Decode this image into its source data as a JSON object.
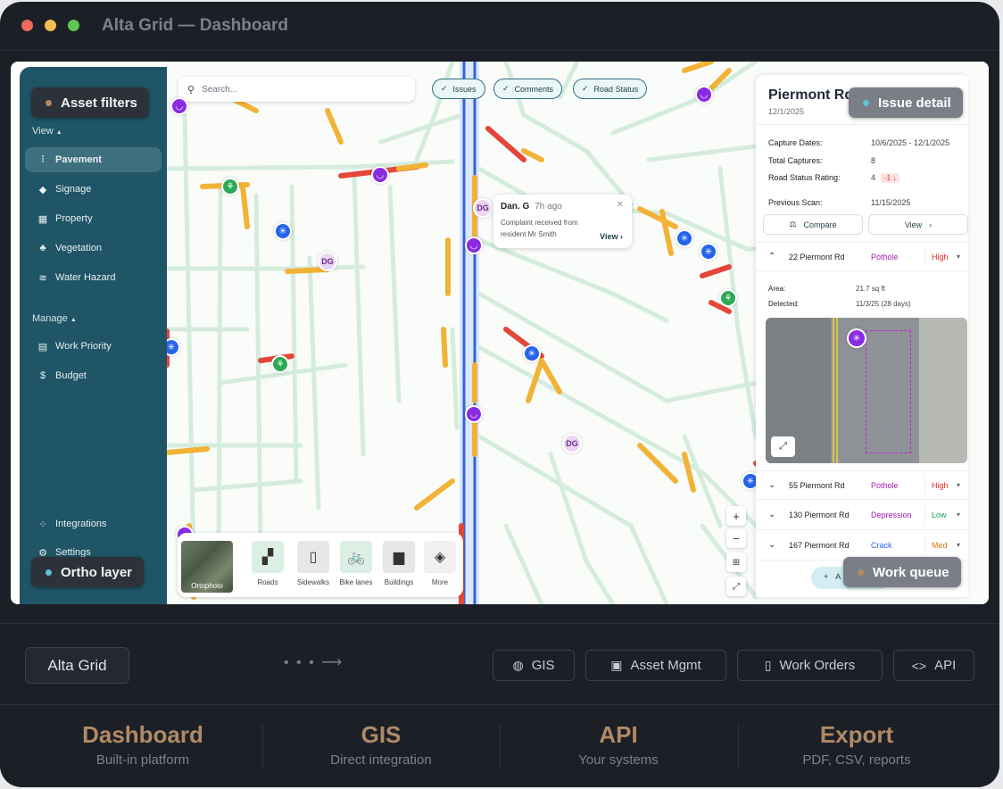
{
  "window": {
    "title": "Alta Grid — Dashboard"
  },
  "sidebar": {
    "view_label": "View",
    "manage_label": "Manage",
    "view_items": [
      {
        "label": "Pavement",
        "icon": "sliders-icon"
      },
      {
        "label": "Signage",
        "icon": "diamond-sign-icon"
      },
      {
        "label": "Property",
        "icon": "building-icon"
      },
      {
        "label": "Vegetation",
        "icon": "tree-icon"
      },
      {
        "label": "Water Hazard",
        "icon": "water-icon"
      }
    ],
    "manage_items": [
      {
        "label": "Work Priority",
        "icon": "clipboard-icon"
      },
      {
        "label": "Budget",
        "icon": "dollar-icon"
      }
    ],
    "bottom_items": [
      {
        "label": "Integrations",
        "icon": "integrations-icon"
      },
      {
        "label": "Settings",
        "icon": "gear-icon"
      }
    ]
  },
  "map": {
    "search_placeholder": "Search...",
    "chips": [
      "Issues",
      "Comments",
      "Road Status"
    ],
    "avatar_initials": "DG",
    "comment": {
      "author": "Dan. G",
      "time": "7h ago",
      "text": "Complaint received from resident Mr Smith",
      "view_label": "View"
    },
    "layers": {
      "ortho_label": "Ortophoto",
      "items": [
        "Roads",
        "Sidewalks",
        "Bike lanes",
        "Buildings",
        "More"
      ]
    }
  },
  "panel": {
    "title": "Piermont Rd",
    "date": "12/1/2025",
    "rows": [
      {
        "label": "Capture Dates:",
        "value": "10/6/2025 - 12/1/2025"
      },
      {
        "label": "Total Captures:",
        "value": "8"
      },
      {
        "label": "Road Status Rating:",
        "value": "4",
        "badge": "-1 ↓"
      },
      {
        "label": "Previous Scan:",
        "value": "11/15/2025"
      }
    ],
    "compare_label": "Compare",
    "view_label": "View",
    "expanded_issue": {
      "address": "22 Piermont Rd",
      "type": "Pothole",
      "severity": "High",
      "area_label": "Area:",
      "area_value": "21.7 sq ft",
      "detected_label": "Detected:",
      "detected_value": "11/3/25 (28 days)"
    },
    "issues": [
      {
        "address": "55 Piermont Rd",
        "type": "Pothole",
        "severity": "High"
      },
      {
        "address": "130 Piermont Rd",
        "type": "Depression",
        "severity": "Low"
      },
      {
        "address": "167 Piermont Rd",
        "type": "Crack",
        "severity": "Med"
      }
    ],
    "add_label": "A"
  },
  "callouts": {
    "asset_filters": "Asset filters",
    "issue_detail": "Issue detail",
    "ortho_layer": "Ortho layer",
    "work_queue": "Work queue"
  },
  "integration_bar": {
    "brand": "Alta Grid",
    "buttons": [
      {
        "label": "GIS",
        "icon": "globe-icon"
      },
      {
        "label": "Asset Mgmt",
        "icon": "layout-icon"
      },
      {
        "label": "Work Orders",
        "icon": "document-icon"
      },
      {
        "label": "API",
        "icon": "code-icon"
      }
    ]
  },
  "stats": [
    {
      "title": "Dashboard",
      "subtitle": "Built-in platform"
    },
    {
      "title": "GIS",
      "subtitle": "Direct integration"
    },
    {
      "title": "API",
      "subtitle": "Your systems"
    },
    {
      "title": "Export",
      "subtitle": "PDF, CSV, reports"
    }
  ],
  "colors": {
    "sidebar": "#1f5566",
    "accent_purple": "#8a2be2",
    "severity_high": "#d92d20",
    "severity_low": "#16a34a",
    "severity_med": "#d97706",
    "stat_title": "#b08a66"
  }
}
